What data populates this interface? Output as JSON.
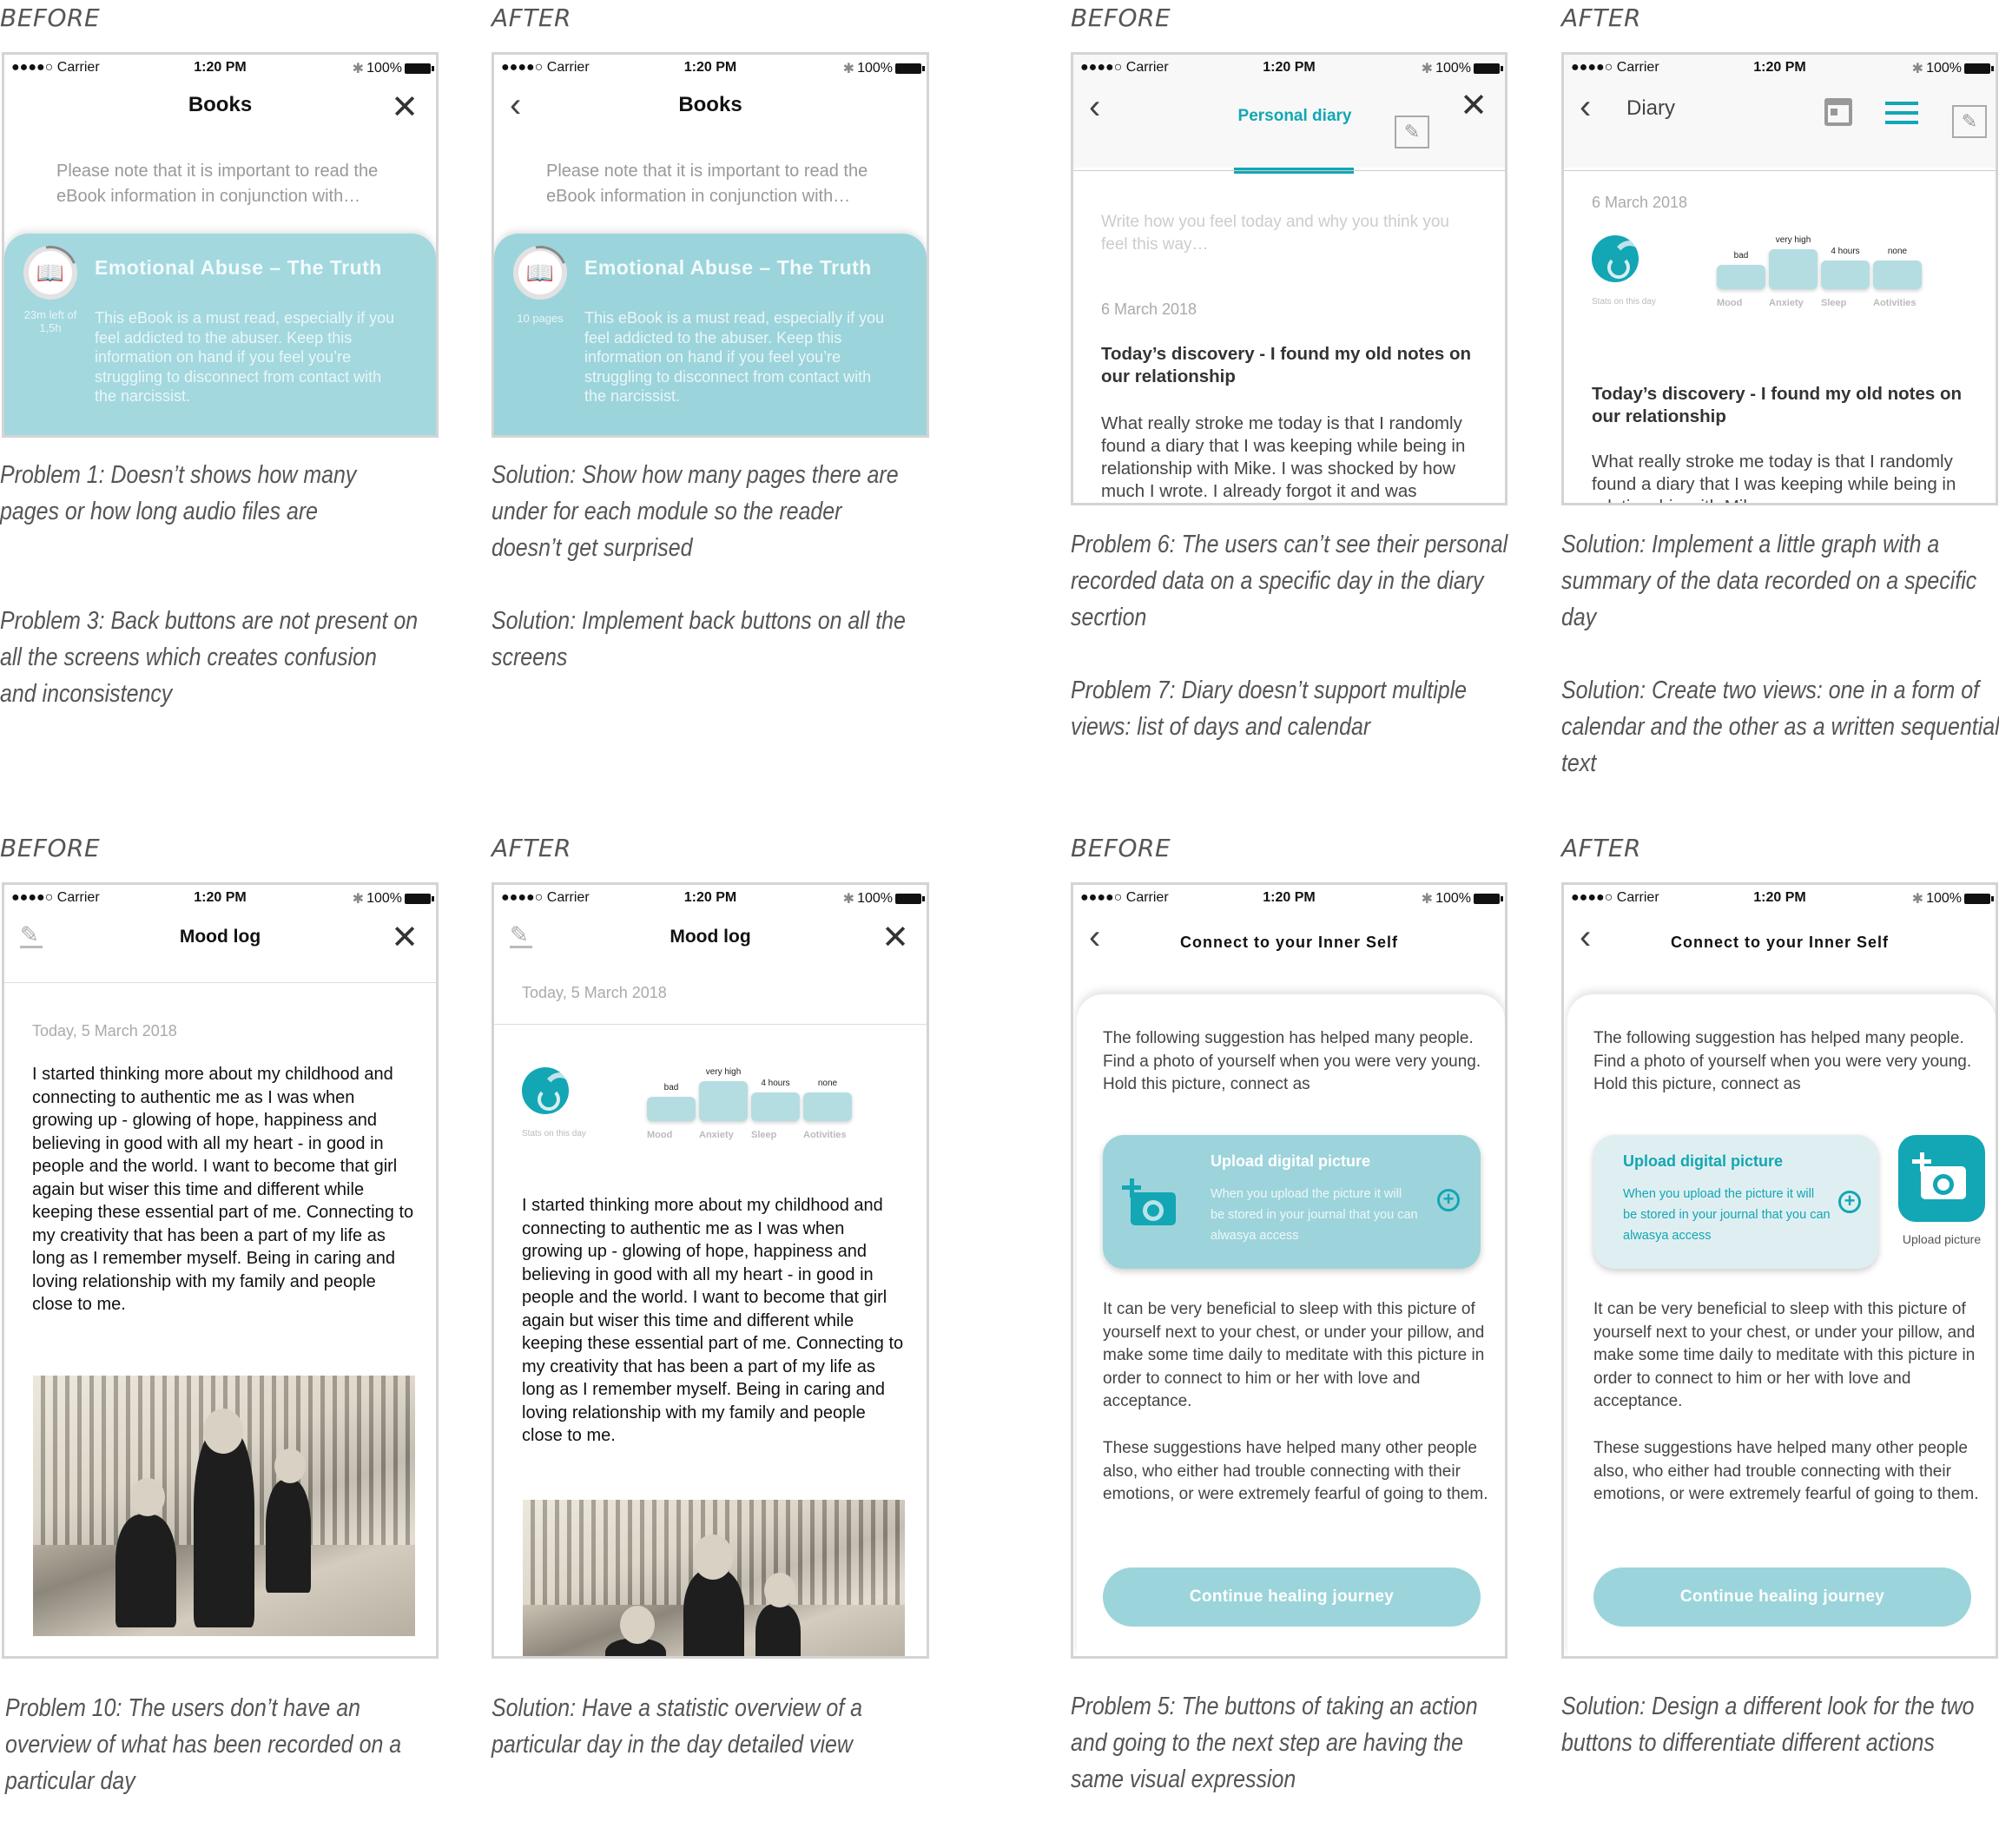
{
  "labels": {
    "before": "BEFORE",
    "after": "AFTER"
  },
  "status_bar": {
    "carrier": "●●●●○ Carrier",
    "wifi": "wifi-icon",
    "time": "1:20 PM",
    "bluetooth": "✱",
    "battery": "100%"
  },
  "books": {
    "title": "Books",
    "intro": "Please note that it is important to read the eBook information in conjunction with…",
    "card_title": "Emotional Abuse – The Truth",
    "card_desc": "This eBook is a must read, especially if you feel addicted to the abuser. Keep this information on hand if you feel you’re struggling to disconnect from contact with the narcissist.",
    "before_meta": "23m left of 1,5h",
    "after_meta": "10 pages",
    "progress": 0.15
  },
  "diary_before": {
    "title": "Personal diary",
    "placeholder": "Write how you feel today and why you think you feel this way…",
    "date": "6 March 2018",
    "entry_title": "Today’s discovery - I found my old notes on our relationship",
    "entry_text": "What really stroke me today is that I randomly found a diary that I was keeping while being in relationship with Mike. I was shocked by how much I wrote. I already forgot it and was"
  },
  "diary_after": {
    "title": "Diary",
    "date": "6 March 2018",
    "entry_title": "Today’s discovery - I found my old notes on our relationship",
    "entry_text": "What really stroke me today is that I randomly found a diary that I was keeping while being in relationship with Mike."
  },
  "stats": {
    "label": "Stats on this day",
    "items": [
      {
        "name": "Mood",
        "value": "bad",
        "level": 0.35
      },
      {
        "name": "Anxiety",
        "value": "very high",
        "level": 1.0
      },
      {
        "name": "Sleep",
        "value": "4 hours",
        "level": 0.55
      },
      {
        "name": "Aotivities",
        "value": "none",
        "level": 0.55
      }
    ]
  },
  "mood_log": {
    "title": "Mood log",
    "date": "Today, 5 March 2018",
    "text": "I started thinking more about my childhood and connecting to authentic me as I was when growing up - glowing of hope, happiness and believing in good with all my heart - in good in people and the world. I want to become that girl again but wiser this time and different while keeping these essential part of me. Connecting to my creativity that has been a part of my life as long as I remember myself. Being in caring and loving relationship with my family and people close to me."
  },
  "inner_self": {
    "title": "Connect to your Inner Self",
    "intro": "The following suggestion has helped many people. Find a photo of yourself when you were very young. Hold this picture, connect as",
    "upload_title": "Upload digital picture",
    "upload_desc": "When you upload the picture it will be stored in your journal that you can alwasya access",
    "upload_button_label": "Upload picture",
    "para1": "It can be very beneficial to sleep with this picture of yourself next to your chest, or under your pillow, and make some time daily to meditate with this picture in order to connect to him or her with love and acceptance.",
    "para2": "These suggestions have helped many other people also, who either had trouble connecting with their emotions, or were extremely fearful of going to them.",
    "cta": "Continue healing journey"
  },
  "captions": {
    "p1": "Problem 1: Doesn’t shows how many pages or how long audio files are",
    "s1": "Solution: Show how many pages there are under for each module so the reader doesn’t get surprised",
    "p3": "Problem 3: Back buttons are not present on all the screens which creates confusion and inconsistency",
    "s3": "Solution:  Implement  back  buttons  on all the screens",
    "p6": "Problem 6: The users can’t see their personal  recorded data on a specific day in the diary secrtion",
    "s6": "Solution: Implement a little graph with a summary of the data recorded on a specific day",
    "p7": "Problem 7: Diary doesn’t support multiple views: list of days and calendar",
    "s7": "Solution: Create two views: one in a form of calendar and the other as a written sequential text",
    "p10": "Problem 10: The users don’t have an overview of what has been recorded on a particular day",
    "s10": "Solution: Have a statistic overview of a particular day in the day detailed view",
    "p5": "Problem 5:  The  buttons  of  taking  an action and going to the next step are having the same visual expression",
    "s5": "Solution: Design a different look for the two buttons to differentiate different actions"
  },
  "colors": {
    "accent": "#13a6b4",
    "card": "#a3d8df",
    "cta": "#9bd5db",
    "stat": "#b4dde2"
  }
}
